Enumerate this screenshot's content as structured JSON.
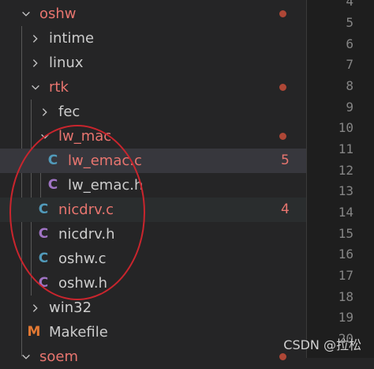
{
  "explorer": {
    "items": [
      {
        "label": "oshw",
        "kind": "folder-open",
        "indicator": "dot"
      },
      {
        "label": "intime",
        "kind": "folder-closed"
      },
      {
        "label": "linux",
        "kind": "folder-closed"
      },
      {
        "label": "rtk",
        "kind": "folder-open",
        "indicator": "dot"
      },
      {
        "label": "fec",
        "kind": "folder-closed"
      },
      {
        "label": "lw_mac",
        "kind": "folder-open",
        "indicator": "dot"
      },
      {
        "label": "lw_emac.c",
        "kind": "file-c",
        "icon_glyph": "C",
        "badge": "5"
      },
      {
        "label": "lw_emac.h",
        "kind": "file-h",
        "icon_glyph": "C"
      },
      {
        "label": "nicdrv.c",
        "kind": "file-c",
        "icon_glyph": "C",
        "badge": "4"
      },
      {
        "label": "nicdrv.h",
        "kind": "file-h",
        "icon_glyph": "C"
      },
      {
        "label": "oshw.c",
        "kind": "file-c",
        "icon_glyph": "C"
      },
      {
        "label": "oshw.h",
        "kind": "file-h",
        "icon_glyph": "C"
      },
      {
        "label": "win32",
        "kind": "folder-closed"
      },
      {
        "label": "Makefile",
        "kind": "makefile",
        "icon_glyph": "M"
      },
      {
        "label": "soem",
        "kind": "folder-open",
        "indicator": "dot"
      }
    ]
  },
  "editor": {
    "line_numbers": [
      "4",
      "5",
      "6",
      "7",
      "8",
      "9",
      "10",
      "11",
      "12",
      "13",
      "14",
      "15",
      "16",
      "17",
      "18",
      "19",
      "20"
    ]
  },
  "watermark": "CSDN @拉松",
  "colors": {
    "sidebar_bg": "#252526",
    "editor_bg": "#1e1e1e",
    "modified_text": "#e2c08d",
    "error_text": "#e8756f",
    "c_icon": "#519aba",
    "h_icon": "#a074c4",
    "makefile_icon": "#e37933",
    "annotation_circle": "#c9252d"
  }
}
